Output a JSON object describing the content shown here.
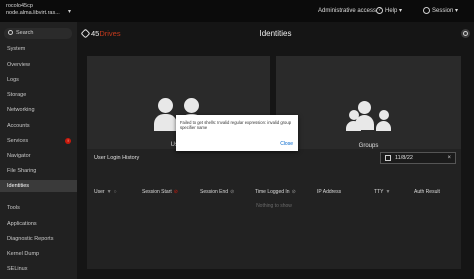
{
  "header": {
    "host_line1": "rocolo45cp",
    "host_line2": "node.alma.libvirt.ras...",
    "admin_access": "Administrative access",
    "help_label": "Help",
    "session_label": "Session"
  },
  "sidebar": {
    "search_placeholder": "Search",
    "items": [
      {
        "label": "System"
      },
      {
        "label": "Overview"
      },
      {
        "label": "Logs"
      },
      {
        "label": "Storage"
      },
      {
        "label": "Networking"
      },
      {
        "label": "Accounts"
      },
      {
        "label": "Services",
        "badge": "!"
      },
      {
        "label": "Navigator"
      },
      {
        "label": "File Sharing"
      },
      {
        "label": "Identities"
      },
      {
        "label": "Tools"
      },
      {
        "label": "Applications"
      },
      {
        "label": "Diagnostic Reports"
      },
      {
        "label": "Kernel Dump"
      },
      {
        "label": "SELinux"
      }
    ]
  },
  "main": {
    "logo_part1": "45",
    "logo_part2": "Drives",
    "title": "Identities",
    "cards": {
      "users_label": "Users",
      "groups_label": "Groups"
    },
    "history": {
      "title": "User Login History",
      "date": "11/8/22",
      "columns": [
        "User",
        "Session Start",
        "Session End",
        "Time Logged In",
        "IP Address",
        "TTY",
        "Auth Result"
      ],
      "empty_text": "Nothing to show"
    }
  },
  "modal": {
    "message": "Failed to get shells: Invalid regular expression: invalid group specifier name",
    "close_label": "Close"
  },
  "colors": {
    "accent_red": "#c9190b",
    "link_blue": "#0066cc",
    "brand_orange": "#c43a1d"
  }
}
